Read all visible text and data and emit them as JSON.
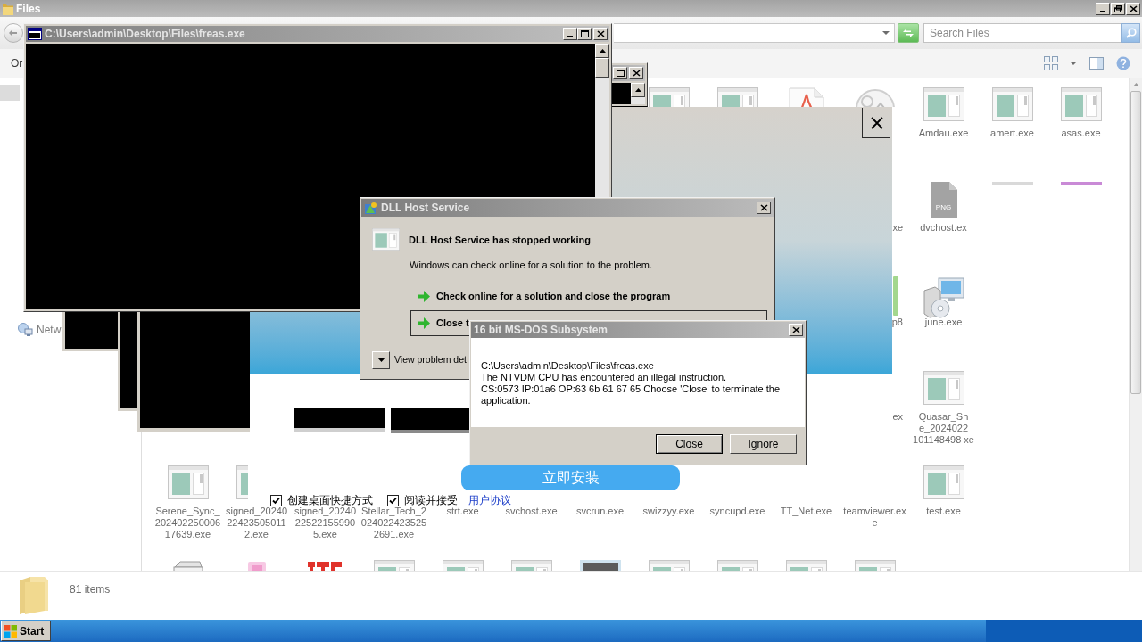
{
  "explorer": {
    "title": "Files",
    "search": {
      "placeholder": "Search Files"
    },
    "toolbar": {
      "menu": "Or"
    },
    "sidebar": {
      "items": [
        {
          "label": "Netw"
        }
      ]
    },
    "files": [
      {
        "kind": "app"
      },
      {
        "kind": "app"
      },
      {
        "kind": "pdf"
      },
      {
        "kind": "graphic"
      },
      {
        "kind": "app",
        "label": "Amdau.exe",
        "clipped": false
      },
      {
        "kind": "app",
        "label": "amert.exe",
        "clipped": false
      },
      {
        "kind": "app",
        "label": "asas.exe",
        "clipped": false
      },
      {
        "label": "xe",
        "clipped": true
      },
      {
        "kind": "png",
        "badge": "PNG",
        "label": "dvchost.ex",
        "clipped": false
      },
      {
        "kind": "stub",
        "color": "#d9d9d9"
      },
      {
        "kind": "stub",
        "color": "#c98ad6"
      },
      {
        "kind": "sliver",
        "color": "#a3d78e",
        "label": "p8",
        "clipped": true
      },
      {
        "kind": "installer",
        "label": "june.exe",
        "clipped": false
      },
      {
        "label": "ex",
        "clipped": true
      },
      {
        "kind": "app",
        "label": "Quasar_Sh e_2024022 101148498 xe",
        "clipped": false
      },
      {
        "kind": "app",
        "label": "Serene_Sync_20240225000617639.exe",
        "clipped": false
      },
      {
        "kind": "app",
        "label": "signed_20240224235050112.exe",
        "clipped": false
      },
      {
        "label": "signed_20240225221559905.exe",
        "clipped": false
      },
      {
        "label": "Stellar_Tech_20240224235252691.exe",
        "clipped": false
      },
      {
        "label": "strt.exe",
        "clipped": false
      },
      {
        "label": "svchost.exe",
        "clipped": false
      },
      {
        "label": "svcrun.exe",
        "clipped": false
      },
      {
        "label": "swizzyy.exe",
        "clipped": false
      },
      {
        "label": "syncupd.exe",
        "clipped": false
      },
      {
        "label": "TT_Net.exe",
        "clipped": false
      },
      {
        "label": "teamviewer.exe",
        "clipped": false
      },
      {
        "kind": "app",
        "label": "test.exe",
        "clipped": false
      },
      {
        "kind": "printer"
      },
      {
        "kind": "picture"
      },
      {
        "kind": "media"
      },
      {
        "kind": "app"
      },
      {
        "kind": "app"
      },
      {
        "kind": "app"
      },
      {
        "kind": "video"
      },
      {
        "kind": "app"
      },
      {
        "kind": "app"
      },
      {
        "kind": "app"
      },
      {
        "kind": "app"
      }
    ],
    "status_bar": "81 items"
  },
  "console_window": {
    "title": "C:\\Users\\admin\\Desktop\\Files\\freas.exe"
  },
  "installer": {
    "install_button": "立即安装",
    "checkboxes": [
      {
        "label": "创建桌面快捷方式",
        "checked": true
      },
      {
        "label": "阅读并接受",
        "checked": true
      }
    ],
    "link": "用户协议"
  },
  "dll_dialog": {
    "title": "DLL Host Service",
    "heading": "DLL Host Service has stopped working",
    "message": "Windows can check online for a solution to the problem.",
    "options": [
      {
        "label": "Check online for a solution and close the program",
        "focused": false
      },
      {
        "label": "Close t",
        "focused": true
      }
    ],
    "details": "View problem det"
  },
  "dos_dialog": {
    "title": "16 bit MS-DOS Subsystem",
    "message": "C:\\Users\\admin\\Desktop\\Files\\freas.exe\nThe NTVDM CPU has encountered an illegal instruction.\nCS:0573 IP:01a6 OP:63 6b 61 67 65 Choose 'Close' to terminate the application.",
    "buttons": [
      {
        "label": "Close",
        "default": true
      },
      {
        "label": "Ignore",
        "default": false
      }
    ]
  },
  "taskbar": {
    "start_button": "Start"
  }
}
